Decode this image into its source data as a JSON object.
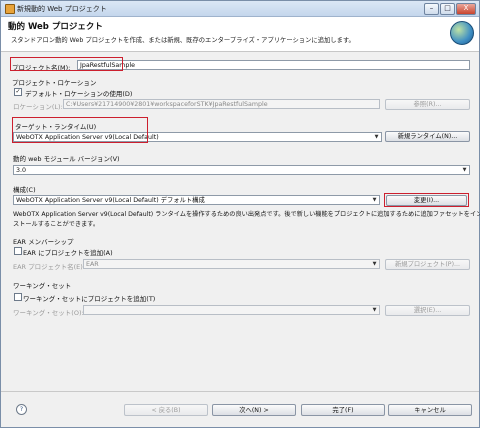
{
  "window": {
    "title": "新規動的 Web プロジェクト",
    "min": "–",
    "max": "□",
    "close": "X"
  },
  "header": {
    "title": "動的 Web プロジェクト",
    "description": "スタンドアロン動的 Web プロジェクトを作成、または新規、既存のエンタープライズ・アプリケーションに追加します。"
  },
  "project_name": {
    "label": "プロジェクト名(M):",
    "value": "JpaRestfulSample"
  },
  "location": {
    "group_label": "プロジェクト・ロケーション",
    "use_default_label": "デフォルト・ロケーションの使用(D)",
    "use_default_checked": true,
    "label": "ロケーション(L):",
    "value": "C:¥Users¥21714900¥2801¥workspaceforSTK¥JpaRestfulSample",
    "browse": "参照(R)..."
  },
  "runtime": {
    "label": "ターゲット・ランタイム(U)",
    "value": "WebOTX Application Server v9(Local Default)",
    "new_button": "新規ランタイム(N)..."
  },
  "module_version": {
    "label": "動的 web モジュール バージョン(V)",
    "value": "3.0"
  },
  "configuration": {
    "label": "構成(C)",
    "value": "WebOTX Application Server v9(Local Default) デフォルト構成",
    "modify_button": "変更(I)...",
    "description_line1": "WebOTX Application Server v9(Local Default) ランタイムを操作するための良い出発点です。後で新しい機能をプロジェクトに追加するために追加ファセットをイン",
    "description_line2": "ストールすることができます。"
  },
  "ear": {
    "group_label": "EAR メンバーシップ",
    "add_label": "EAR にプロジェクトを追加(A)",
    "add_checked": false,
    "name_label": "EAR プロジェクト名(E):",
    "name_value": "EAR",
    "new_button": "新規プロジェクト(P)..."
  },
  "working_set": {
    "group_label": "ワーキング・セット",
    "add_label": "ワーキング・セットにプロジェクトを追加(T)",
    "add_checked": false,
    "label": "ワーキング・セット(O):",
    "value": "",
    "select_button": "選択(E)..."
  },
  "footer": {
    "help": "?",
    "back": "< 戻る(B)",
    "next": "次へ(N) >",
    "finish": "完了(F)",
    "cancel": "キャンセル"
  }
}
